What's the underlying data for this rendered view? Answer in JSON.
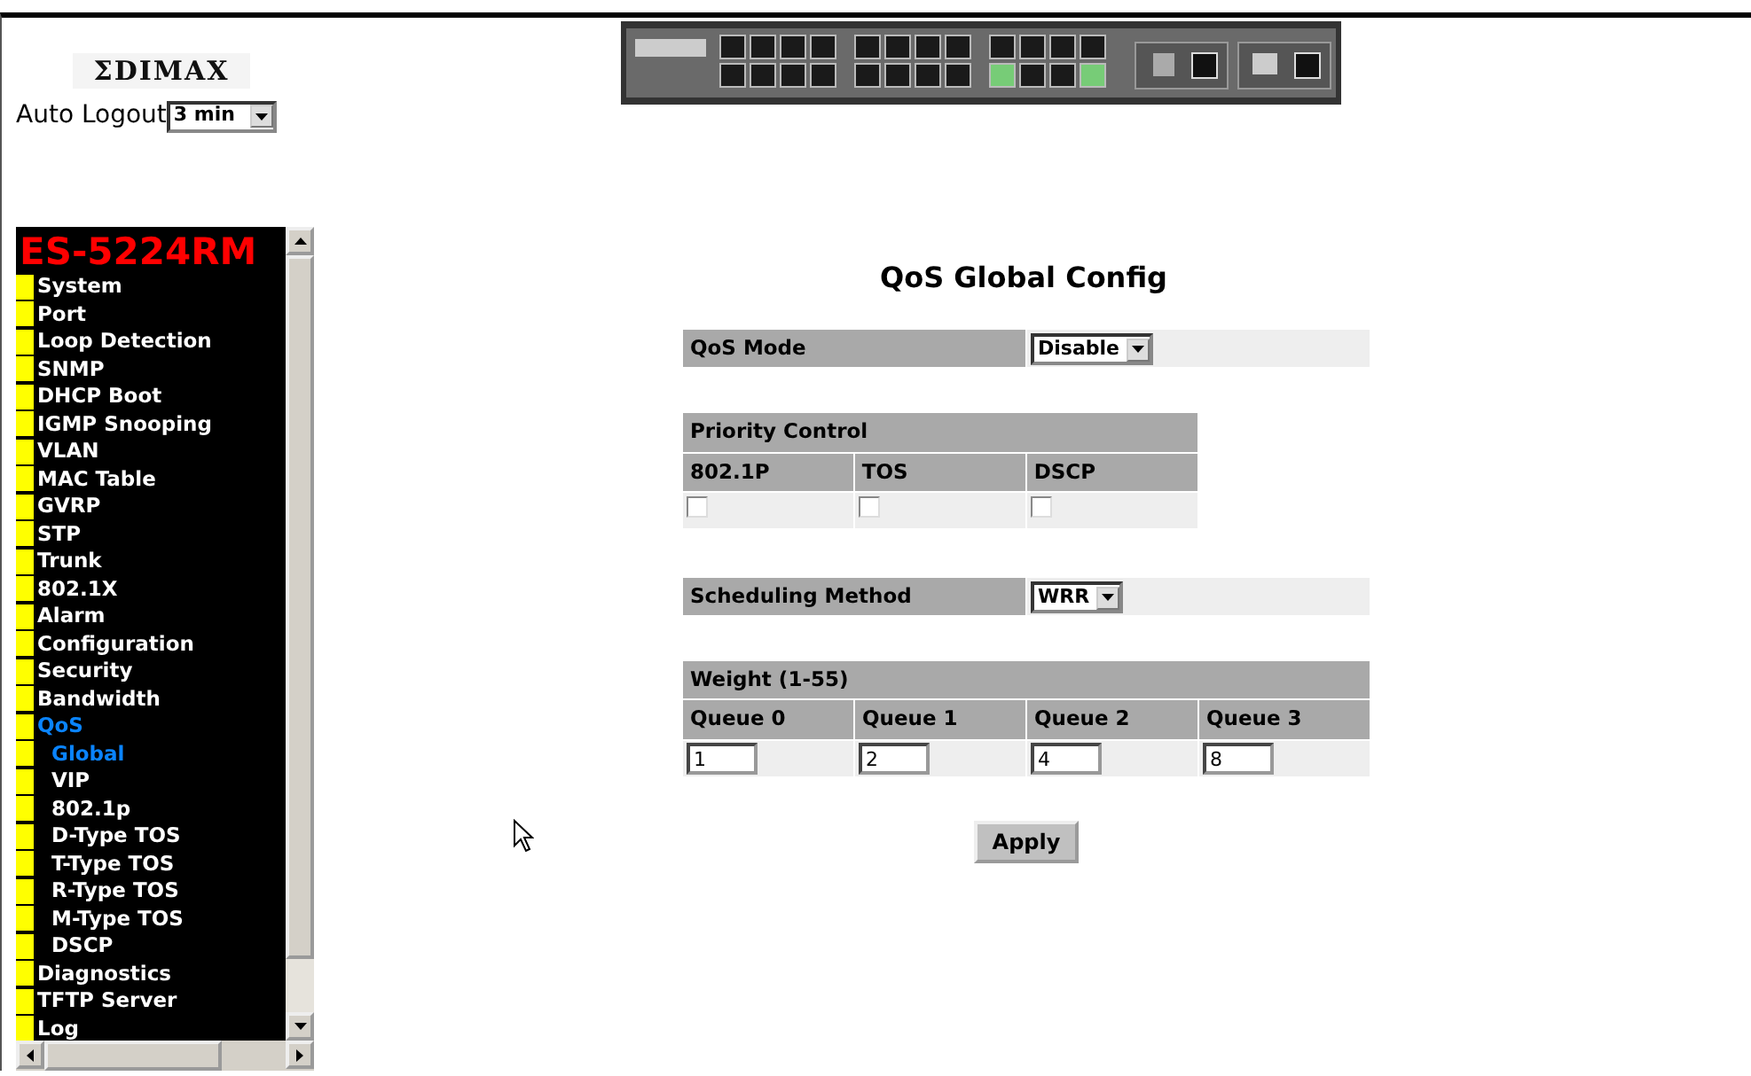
{
  "logo": {
    "text": "ΣDIMAX"
  },
  "auto_logout": {
    "label": "Auto Logout",
    "value": "3 min"
  },
  "sidebar": {
    "title": "ES-5224RM",
    "items": [
      {
        "label": "System",
        "selected": false
      },
      {
        "label": "Port",
        "selected": false
      },
      {
        "label": "Loop Detection",
        "selected": false
      },
      {
        "label": "SNMP",
        "selected": false
      },
      {
        "label": "DHCP Boot",
        "selected": false
      },
      {
        "label": "IGMP Snooping",
        "selected": false
      },
      {
        "label": "VLAN",
        "selected": false
      },
      {
        "label": "MAC Table",
        "selected": false
      },
      {
        "label": "GVRP",
        "selected": false
      },
      {
        "label": "STP",
        "selected": false
      },
      {
        "label": "Trunk",
        "selected": false
      },
      {
        "label": "802.1X",
        "selected": false
      },
      {
        "label": "Alarm",
        "selected": false
      },
      {
        "label": "Configuration",
        "selected": false
      },
      {
        "label": "Security",
        "selected": false
      },
      {
        "label": "Bandwidth",
        "selected": false
      },
      {
        "label": "QoS",
        "selected": true,
        "children": [
          {
            "label": "Global",
            "selected": true
          },
          {
            "label": "VIP",
            "selected": false
          },
          {
            "label": "802.1p",
            "selected": false
          },
          {
            "label": "D-Type TOS",
            "selected": false
          },
          {
            "label": "T-Type TOS",
            "selected": false
          },
          {
            "label": "R-Type TOS",
            "selected": false
          },
          {
            "label": "M-Type TOS",
            "selected": false
          },
          {
            "label": "DSCP",
            "selected": false
          }
        ]
      },
      {
        "label": "Diagnostics",
        "selected": false
      },
      {
        "label": "TFTP Server",
        "selected": false
      },
      {
        "label": "Log",
        "selected": false
      }
    ]
  },
  "page_title": "QoS Global Config",
  "qos_mode": {
    "label": "QoS Mode",
    "value": "Disable"
  },
  "priority_control": {
    "title": "Priority Control",
    "options": [
      {
        "label": "802.1P",
        "checked": false
      },
      {
        "label": "TOS",
        "checked": false
      },
      {
        "label": "DSCP",
        "checked": false
      }
    ]
  },
  "scheduling_method": {
    "label": "Scheduling Method",
    "value": "WRR"
  },
  "weight": {
    "title": "Weight (1-55)",
    "queues": [
      {
        "label": "Queue 0",
        "value": "1"
      },
      {
        "label": "Queue 1",
        "value": "2"
      },
      {
        "label": "Queue 2",
        "value": "4"
      },
      {
        "label": "Queue 3",
        "value": "8"
      }
    ]
  },
  "apply_button": "Apply"
}
